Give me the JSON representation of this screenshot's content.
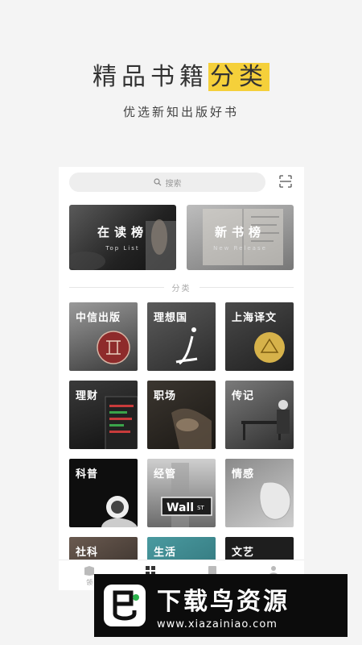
{
  "hero": {
    "title_plain": "精品书籍",
    "title_highlight": "分类",
    "subtitle": "优选新知出版好书",
    "highlight_color": "#f5d03a"
  },
  "search": {
    "placeholder": "搜索",
    "icon": "search-icon"
  },
  "scan": {
    "icon": "scan-icon"
  },
  "banners": [
    {
      "title": "在读榜",
      "subtitle": "Top List"
    },
    {
      "title": "新书榜",
      "subtitle": "New Release"
    }
  ],
  "section": {
    "label": "分类"
  },
  "categories": [
    {
      "label": "中信出版"
    },
    {
      "label": "理想国"
    },
    {
      "label": "上海译文"
    },
    {
      "label": "理财"
    },
    {
      "label": "职场"
    },
    {
      "label": "传记"
    },
    {
      "label": "科普"
    },
    {
      "label": "经管"
    },
    {
      "label": "情感"
    },
    {
      "label": "社科"
    },
    {
      "label": "生活"
    },
    {
      "label": "文艺"
    }
  ],
  "tiles_art": {
    "wall_sign": "Wall",
    "wall_st": "ST"
  },
  "tabbar": {
    "items": [
      {
        "label": "领",
        "icon": "bookstore-icon"
      },
      {
        "label": "",
        "icon": "category-icon"
      },
      {
        "label": "",
        "icon": "bookshelf-icon"
      },
      {
        "label": "",
        "icon": "profile-icon"
      }
    ]
  },
  "watermark": {
    "title": "下载鸟资源",
    "url": "www.xiazainiao.com"
  }
}
